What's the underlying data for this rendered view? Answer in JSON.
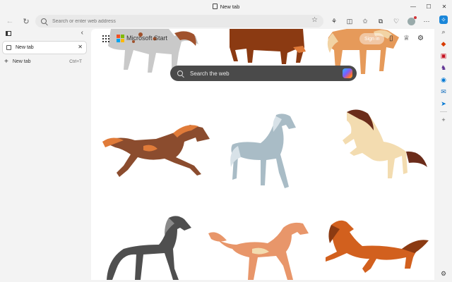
{
  "window": {
    "tab_title": "New tab",
    "controls": [
      "minimize-icon",
      "maximize-icon",
      "close-icon"
    ]
  },
  "toolbar": {
    "address_placeholder": "Search or enter web address",
    "buttons": [
      "back-icon",
      "refresh-icon",
      "favorite-star-icon",
      "extensions-icon",
      "split-screen-icon",
      "favorites-icon",
      "collections-icon",
      "browser-essentials-icon",
      "profile-avatar",
      "more-icon"
    ]
  },
  "vertical_tabs": {
    "tabs": [
      {
        "label": "New tab"
      }
    ],
    "new_tab_label": "New tab",
    "new_tab_shortcut": "Ctrl+T"
  },
  "ntp": {
    "brand": "Microsoft Start",
    "sign_in": "Sign in",
    "search_placeholder": "Search the web",
    "background": "illustrated horses"
  },
  "sidebar": {
    "icons": [
      "copilot-icon",
      "search-icon",
      "shopping-icon",
      "tools-icon",
      "games-icon",
      "microsoft-365-icon",
      "outlook-icon",
      "drop-icon",
      "add-icon",
      "settings-icon"
    ]
  },
  "colors": {
    "accent": "#0f6cbd",
    "search_bar": "#4a4a4a",
    "page_bg": "#ffffff",
    "chrome_bg": "#f3f3f3"
  }
}
